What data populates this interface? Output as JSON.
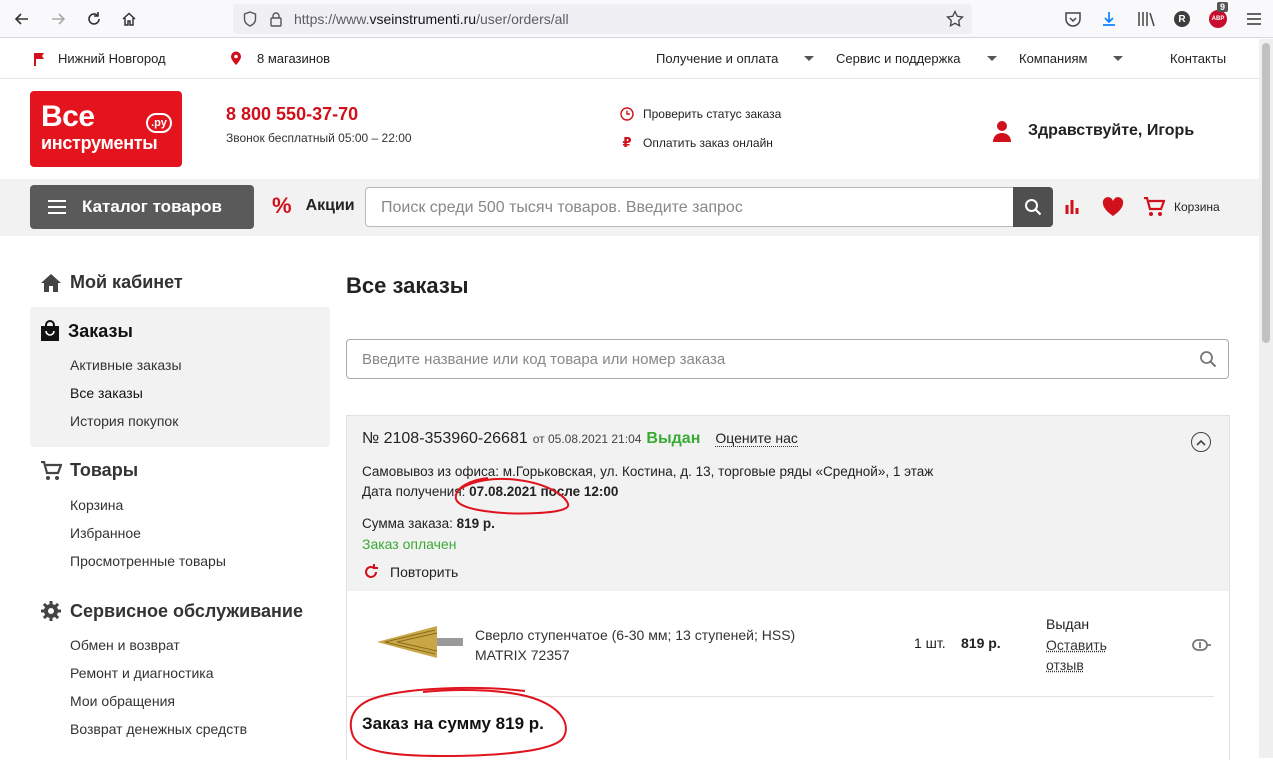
{
  "browser": {
    "url_prefix": "https://www.",
    "url_domain": "vseinstrumenti.ru",
    "url_path": "/user/orders/all",
    "badge_count": "9",
    "profile_letter": "R",
    "ext_badge": "ABP"
  },
  "topstrip": {
    "city": "Нижний Новгород",
    "stores": "8 магазинов",
    "menu": [
      "Получение и оплата",
      "Сервис и поддержка",
      "Компаниям"
    ],
    "contacts": "Контакты"
  },
  "header": {
    "logo_line1": "Все",
    "logo_line2": "инструменты",
    "logo_ru": ".ру",
    "phone": "8 800 550-37-70",
    "phone_sub": "Звонок бесплатный 05:00 – 22:00",
    "check_status": "Проверить статус заказа",
    "pay_online": "Оплатить заказ онлайн",
    "greeting": "Здравствуйте, Игорь"
  },
  "greybar": {
    "catalog": "Каталог товаров",
    "promo": "Акции",
    "search_placeholder": "Поиск среди 500 тысяч товаров. Введите запрос",
    "cart": "Корзина"
  },
  "sidebar": {
    "cabinet": "Мой кабинет",
    "orders": "Заказы",
    "orders_links": [
      "Активные заказы",
      "Все заказы",
      "История покупок"
    ],
    "goods": "Товары",
    "goods_links": [
      "Корзина",
      "Избранное",
      "Просмотренные товары"
    ],
    "service": "Сервисное обслуживание",
    "service_links": [
      "Обмен и возврат",
      "Ремонт и диагностика",
      "Мои обращения",
      "Возврат денежных средств"
    ]
  },
  "main": {
    "title": "Все заказы",
    "search_placeholder": "Введите название или код товара или номер заказа",
    "order": {
      "number": "№ 2108-353960-26681",
      "date": "от 05.08.2021 21:04",
      "status": "Выдан",
      "rate": "Оцените нас",
      "pickup": "Самовывоз из офиса: м.Горьковская, ул. Костина, д. 13, торговые ряды «Средной», 1 этаж",
      "receive_label": "Дата получения:",
      "receive_value": "07.08.2021 после 12:00",
      "sum_label": "Сумма заказа:",
      "sum_value": "819 р.",
      "paid": "Заказ оплачен",
      "repeat": "Повторить",
      "item": {
        "name": "Сверло ступенчатое (6-30 мм; 13 ступеней; HSS)",
        "brand": "MATRIX 72357",
        "qty": "1 шт.",
        "price": "819 р.",
        "status": "Выдан",
        "review_line1": "Оставить",
        "review_line2": "отзыв"
      },
      "total": "Заказ на сумму 819 р."
    }
  },
  "colors": {
    "brand_red": "#e4141e",
    "status_green": "#3aaa35",
    "annotation_red": "#e0141e"
  }
}
